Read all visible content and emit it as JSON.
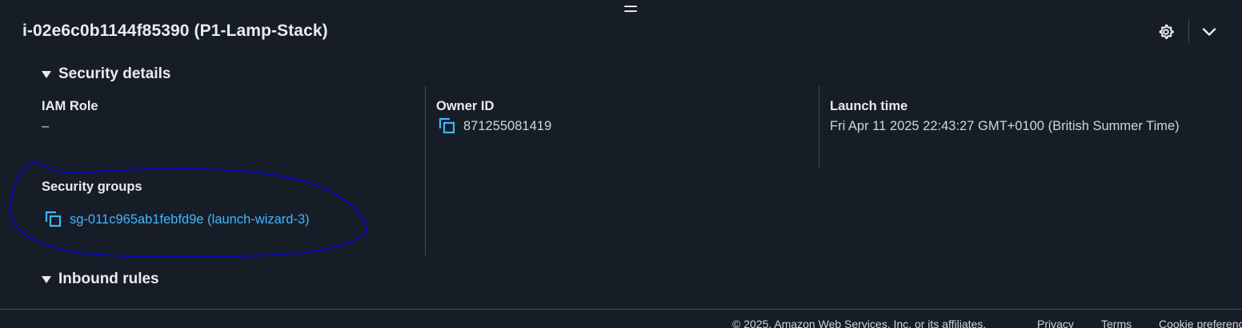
{
  "panel": {
    "title": "i-02e6c0b1144f85390 (P1-Lamp-Stack)"
  },
  "sections": {
    "security_details": "Security details",
    "inbound_rules": "Inbound rules"
  },
  "security": {
    "iam_role_label": "IAM Role",
    "iam_role_value": "–",
    "owner_id_label": "Owner ID",
    "owner_id_value": "871255081419",
    "launch_time_label": "Launch time",
    "launch_time_value": "Fri Apr 11 2025 22:43:27 GMT+0100 (British Summer Time)",
    "security_groups_label": "Security groups",
    "security_group_link": "sg-011c965ab1febfd9e (launch-wizard-3)"
  },
  "footer": {
    "copyright": "© 2025, Amazon Web Services, Inc. or its affiliates.",
    "privacy": "Privacy",
    "terms": "Terms",
    "cookies": "Cookie preferences"
  },
  "icons": {
    "settings": "gear-icon",
    "collapse": "chevron-down-icon",
    "copy": "copy-icon",
    "expand": "caret-down-icon",
    "resize": "drag-handle-icon"
  },
  "colors": {
    "background": "#161d26",
    "link": "#42b4ff",
    "annotation": "#0b0bb0"
  }
}
